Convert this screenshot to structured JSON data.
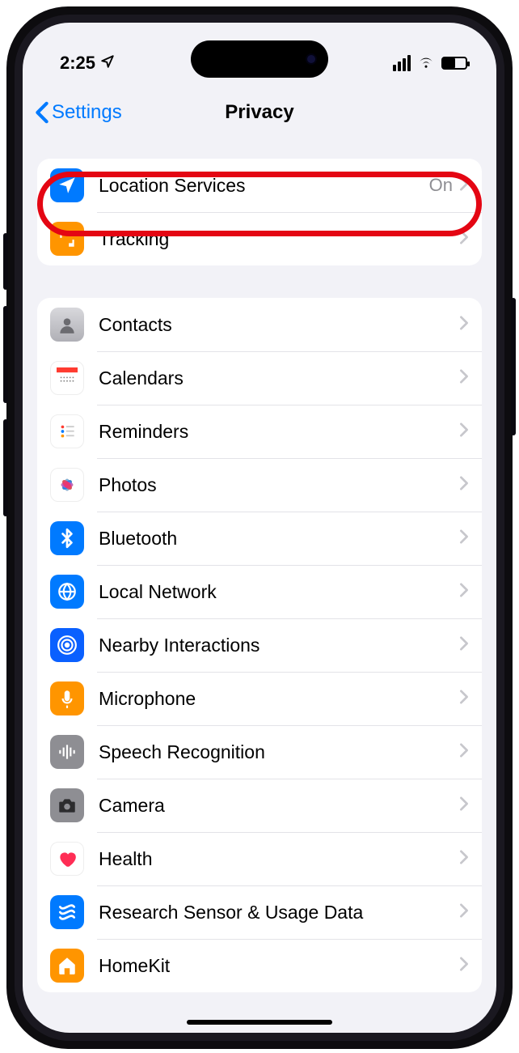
{
  "statusbar": {
    "time": "2:25"
  },
  "nav": {
    "back_label": "Settings",
    "title": "Privacy"
  },
  "group1": [
    {
      "label": "Location Services",
      "value": "On",
      "icon": "location-arrow-icon",
      "bg": "ic-location",
      "highlighted": true
    },
    {
      "label": "Tracking",
      "value": "",
      "icon": "tracking-icon",
      "bg": "ic-tracking"
    }
  ],
  "group2": [
    {
      "label": "Contacts",
      "icon": "contacts-icon",
      "bg": "ic-contacts"
    },
    {
      "label": "Calendars",
      "icon": "calendars-icon",
      "bg": "ic-calendars"
    },
    {
      "label": "Reminders",
      "icon": "reminders-icon",
      "bg": "ic-reminders"
    },
    {
      "label": "Photos",
      "icon": "photos-icon",
      "bg": "ic-photos"
    },
    {
      "label": "Bluetooth",
      "icon": "bluetooth-icon",
      "bg": "ic-bluetooth"
    },
    {
      "label": "Local Network",
      "icon": "local-network-icon",
      "bg": "ic-localnet"
    },
    {
      "label": "Nearby Interactions",
      "icon": "nearby-icon",
      "bg": "ic-nearby"
    },
    {
      "label": "Microphone",
      "icon": "microphone-icon",
      "bg": "ic-mic"
    },
    {
      "label": "Speech Recognition",
      "icon": "speech-icon",
      "bg": "ic-speech"
    },
    {
      "label": "Camera",
      "icon": "camera-icon",
      "bg": "ic-camera"
    },
    {
      "label": "Health",
      "icon": "health-icon",
      "bg": "ic-health"
    },
    {
      "label": "Research Sensor & Usage Data",
      "icon": "research-icon",
      "bg": "ic-research"
    },
    {
      "label": "HomeKit",
      "icon": "homekit-icon",
      "bg": "ic-homekit"
    }
  ]
}
